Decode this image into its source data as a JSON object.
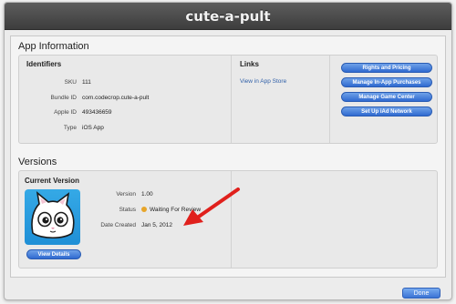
{
  "window": {
    "title": "cute-a-pult"
  },
  "app_info": {
    "section_title": "App Information",
    "identifiers": {
      "heading": "Identifiers",
      "rows": [
        {
          "label": "SKU",
          "value": "111"
        },
        {
          "label": "Bundle ID",
          "value": "com.codecrop.cute-a-pult"
        },
        {
          "label": "Apple ID",
          "value": "493436659"
        },
        {
          "label": "Type",
          "value": "iOS App"
        }
      ]
    },
    "links": {
      "heading": "Links",
      "view_in_app_store": "View in App Store"
    },
    "actions": [
      "Rights and Pricing",
      "Manage In-App Purchases",
      "Manage Game Center",
      "Set Up iAd Network"
    ]
  },
  "versions": {
    "section_title": "Versions",
    "current_version": {
      "heading": "Current Version",
      "view_details": "View Details",
      "version_label": "Version",
      "version_value": "1.00",
      "status_label": "Status",
      "status_value": "Waiting For Review",
      "date_label": "Date Created",
      "date_value": "Jan 5, 2012"
    }
  },
  "footer": {
    "done_label": "Done"
  },
  "colors": {
    "titlebar": "#4a4a4a",
    "accent_blue": "#2f6ad0",
    "status_pending": "#e7a52a",
    "annotation_arrow": "#e0201c",
    "icon_background": "#2a9fe2"
  }
}
